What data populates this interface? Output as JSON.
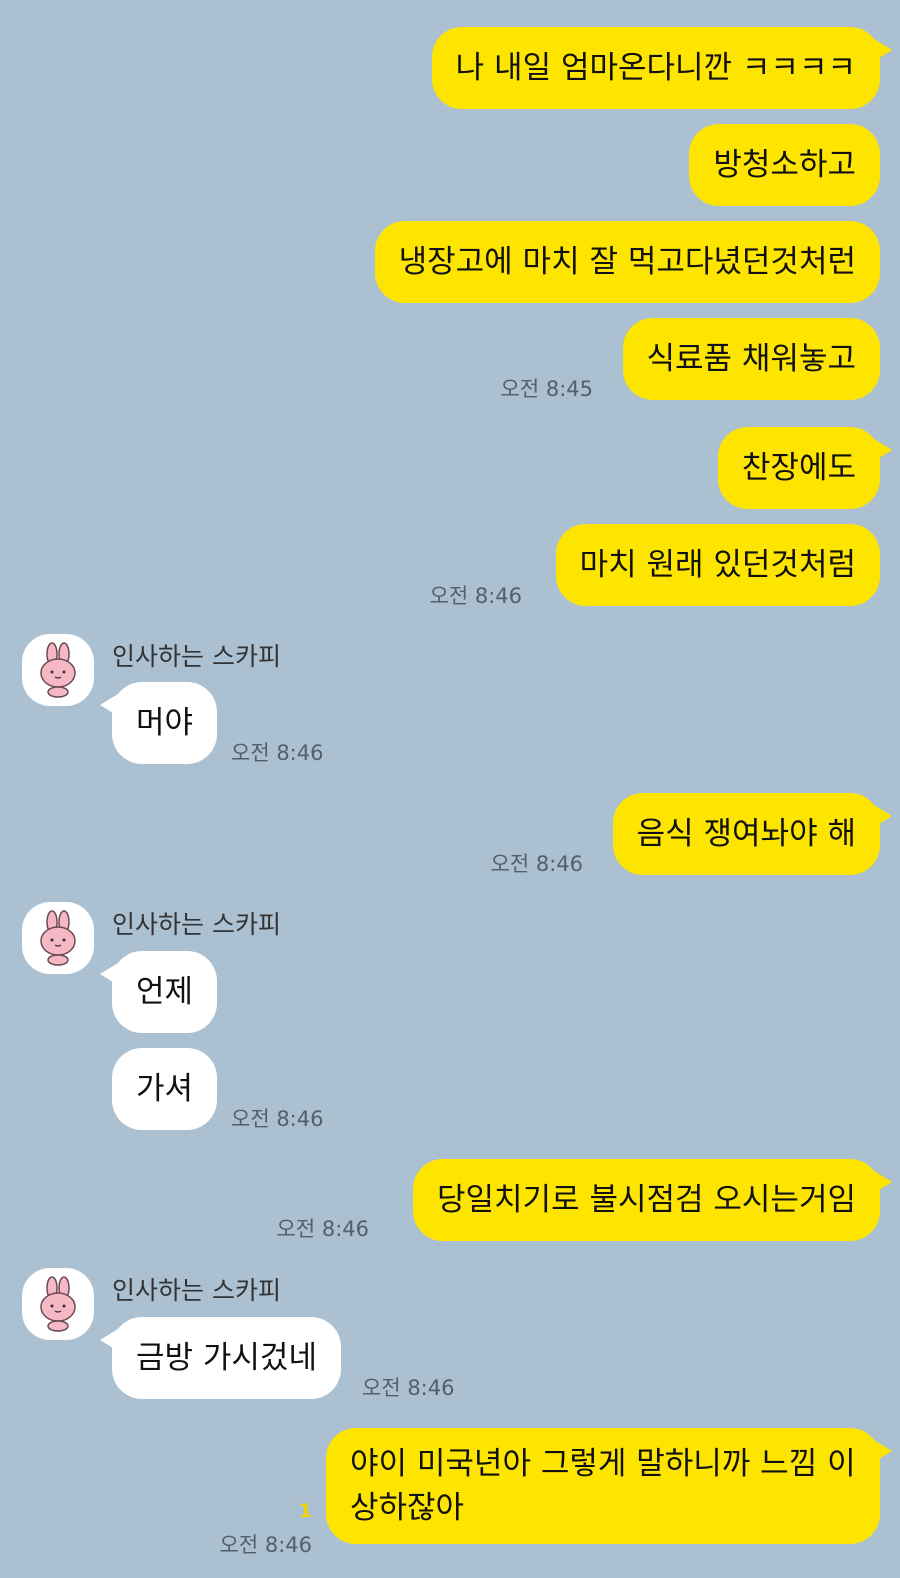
{
  "contact_name": "인사하는 스카피",
  "colors": {
    "background": "#abc1d1",
    "my_bubble": "#fee500",
    "their_bubble": "#ffffff"
  },
  "messages": [
    {
      "sender": "me",
      "text": "나 내일 엄마온다니깐 ㅋㅋㅋㅋ"
    },
    {
      "sender": "me",
      "text": "방청소하고"
    },
    {
      "sender": "me",
      "text": "냉장고에 마치 잘 먹고다녔던것처런"
    },
    {
      "sender": "me",
      "text": "식료품 채워놓고",
      "time": "오전 8:45"
    },
    {
      "sender": "me",
      "text": "찬장에도"
    },
    {
      "sender": "me",
      "text": "마치 원래 있던것처럼",
      "time": "오전 8:46"
    },
    {
      "sender": "them",
      "text": "머야",
      "time": "오전 8:46"
    },
    {
      "sender": "me",
      "text": "음식 쟁여놔야 해",
      "time": "오전 8:46"
    },
    {
      "sender": "them",
      "text": "언제"
    },
    {
      "sender": "them",
      "text": "가셔",
      "time": "오전 8:46"
    },
    {
      "sender": "me",
      "text": "당일치기로 불시점검 오시는거임",
      "time": "오전 8:46"
    },
    {
      "sender": "them",
      "text": "금방 가시겄네",
      "time": "오전 8:46"
    },
    {
      "sender": "me",
      "text": "야이 미국년아 그렇게 말하니까 느낌 이상하잖아",
      "time": "오전 8:46",
      "unread": "1"
    }
  ]
}
